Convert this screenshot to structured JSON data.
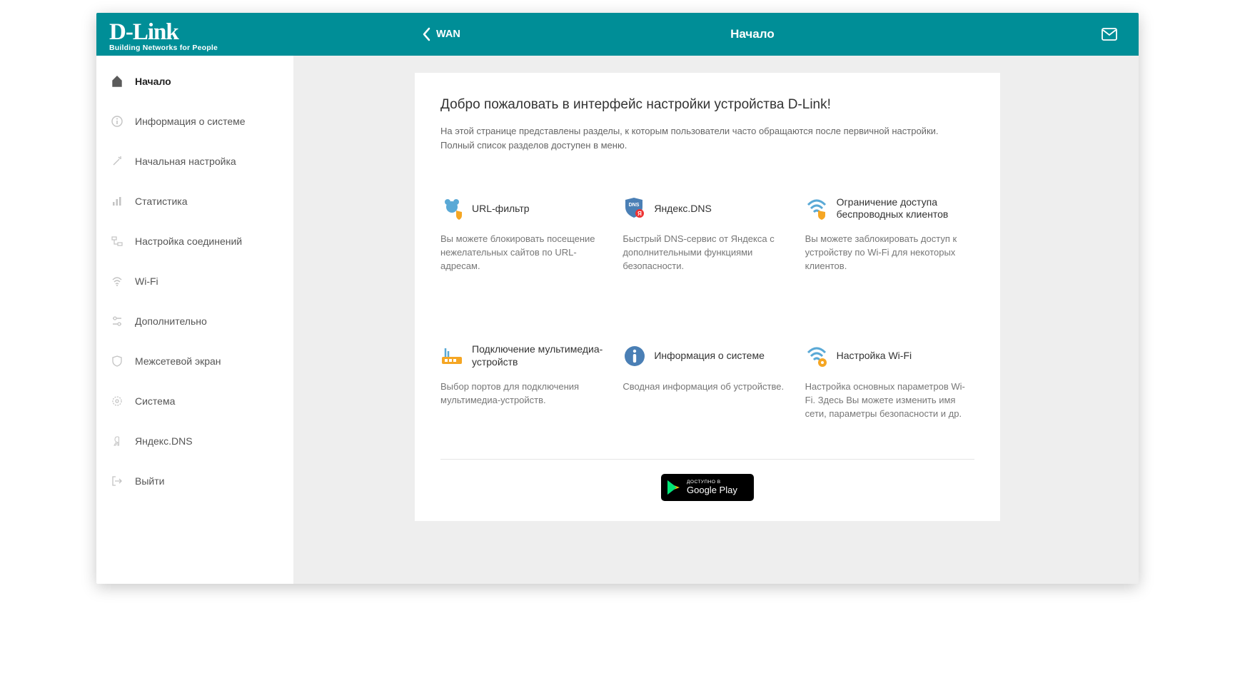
{
  "brand": {
    "name": "D-Link",
    "tagline": "Building Networks for People"
  },
  "header": {
    "back_label": "WAN",
    "title": "Начало"
  },
  "sidebar": {
    "items": [
      {
        "label": "Начало"
      },
      {
        "label": "Информация о системе"
      },
      {
        "label": "Начальная настройка"
      },
      {
        "label": "Статистика"
      },
      {
        "label": "Настройка соединений"
      },
      {
        "label": "Wi-Fi"
      },
      {
        "label": "Дополнительно"
      },
      {
        "label": "Межсетевой экран"
      },
      {
        "label": "Система"
      },
      {
        "label": "Яндекс.DNS"
      },
      {
        "label": "Выйти"
      }
    ]
  },
  "main": {
    "welcome_title": "Добро пожаловать в интерфейс настройки устройства D-Link!",
    "welcome_desc": "На этой странице представлены разделы, к которым пользователи часто обращаются после первичной настройки. Полный список разделов доступен в меню.",
    "tiles": [
      {
        "title": "URL-фильтр",
        "desc": "Вы можете блокировать посещение нежелательных сайтов по URL-адресам."
      },
      {
        "title": "Яндекс.DNS",
        "desc": "Быстрый DNS-сервис от Яндекса с дополнительными функциями безопасности."
      },
      {
        "title": "Ограничение доступа беспроводных клиентов",
        "desc": "Вы можете заблокировать доступ к устройству по Wi-Fi для некоторых клиентов."
      },
      {
        "title": "Подключение мультимедиа-устройств",
        "desc": "Выбор портов для подключения мультимедиа-устройств."
      },
      {
        "title": "Информация о системе",
        "desc": "Сводная информация об устройстве."
      },
      {
        "title": "Настройка Wi-Fi",
        "desc": "Настройка основных параметров Wi-Fi. Здесь Вы можете изменить имя сети, параметры безопасности и др."
      }
    ]
  },
  "gplay": {
    "avail": "ДОСТУПНО В",
    "store": "Google Play"
  }
}
